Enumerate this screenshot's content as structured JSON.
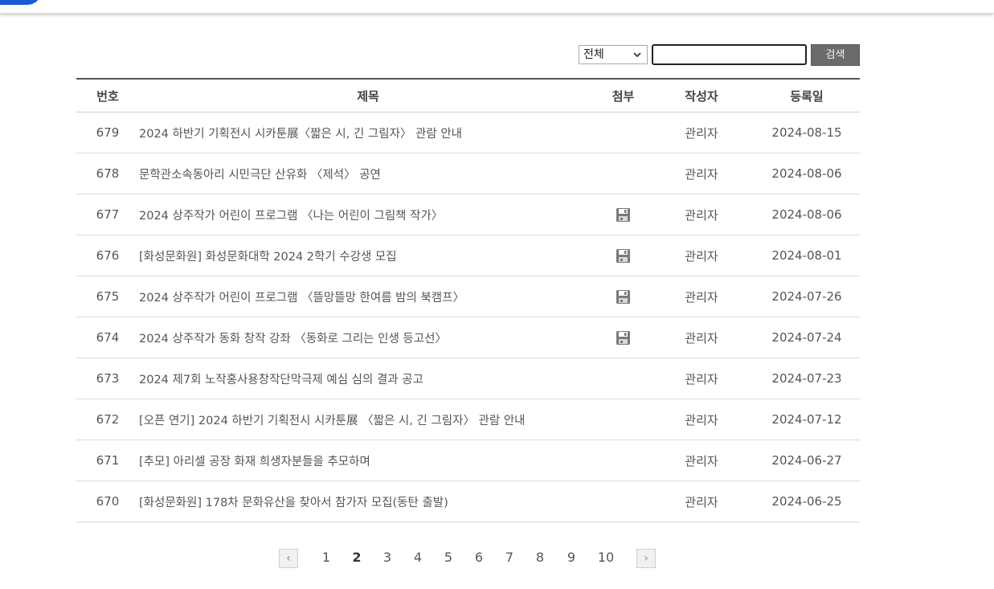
{
  "search": {
    "scope_selected": "전체",
    "input_value": "",
    "button_label": "검색"
  },
  "table": {
    "headers": {
      "no": "번호",
      "title": "제목",
      "file": "첨부",
      "author": "작성자",
      "date": "등록일"
    },
    "rows": [
      {
        "no": "679",
        "title": "2024 하반기 기획전시 시카툰展〈짧은 시, 긴 그림자〉 관람 안내",
        "attachment": false,
        "author": "관리자",
        "date": "2024-08-15"
      },
      {
        "no": "678",
        "title": "문학관소속동아리 시민극단 산유화 〈제석〉 공연",
        "attachment": false,
        "author": "관리자",
        "date": "2024-08-06"
      },
      {
        "no": "677",
        "title": "2024 상주작가 어린이 프로그램 〈나는 어린이 그림책 작가〉",
        "attachment": true,
        "author": "관리자",
        "date": "2024-08-06"
      },
      {
        "no": "676",
        "title": "[화성문화원] 화성문화대학 2024 2학기 수강생 모집",
        "attachment": true,
        "author": "관리자",
        "date": "2024-08-01"
      },
      {
        "no": "675",
        "title": "2024 상주작가 어린이 프로그램 〈뜰망뜰망 한여름 밤의 북캠프〉",
        "attachment": true,
        "author": "관리자",
        "date": "2024-07-26"
      },
      {
        "no": "674",
        "title": "2024 상주작가 동화 창작 강좌 〈동화로 그리는 인생 등고선〉",
        "attachment": true,
        "author": "관리자",
        "date": "2024-07-24"
      },
      {
        "no": "673",
        "title": "2024 제7회 노작홍사용창작단막극제 예심 심의 결과 공고",
        "attachment": false,
        "author": "관리자",
        "date": "2024-07-23"
      },
      {
        "no": "672",
        "title": "[오픈 연기] 2024 하반기 기획전시 시카툰展 〈짧은 시, 긴 그림자〉 관람 안내",
        "attachment": false,
        "author": "관리자",
        "date": "2024-07-12"
      },
      {
        "no": "671",
        "title": "[추모] 아리셀 공장 화재 희생자분들을 추모하며",
        "attachment": false,
        "author": "관리자",
        "date": "2024-06-27"
      },
      {
        "no": "670",
        "title": "[화성문화원] 178차 문화유산을 찾아서 참가자 모집(동탄 출발)",
        "attachment": false,
        "author": "관리자",
        "date": "2024-06-25"
      }
    ]
  },
  "pagination": {
    "prev_icon": "‹",
    "next_icon": "›",
    "pages": [
      "1",
      "2",
      "3",
      "4",
      "5",
      "6",
      "7",
      "8",
      "9",
      "10"
    ],
    "current": "2"
  },
  "colors": {
    "accent": "#1a5bd6",
    "button_bg": "#6b6b6b"
  }
}
